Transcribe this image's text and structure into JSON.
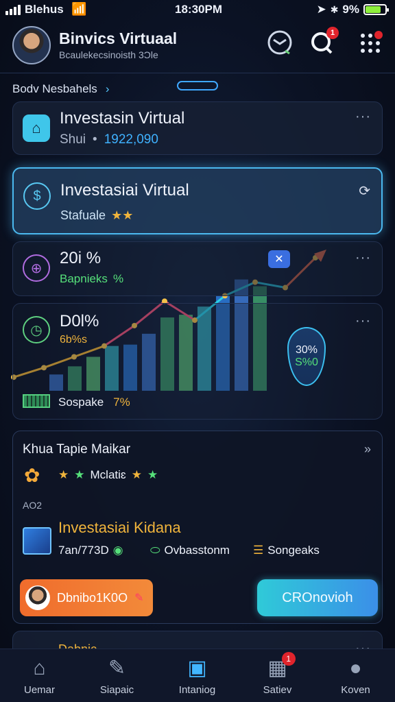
{
  "status_bar": {
    "carrier": "Blehus",
    "time": "18:30PM",
    "battery_text": "9%"
  },
  "header": {
    "title": "Binvics Virtuaal",
    "subtitle": "Bcaulekecsinoisth 3Ͻle",
    "notification_badge": "1"
  },
  "breadcrumb": {
    "label": "Bodv Nesbahels",
    "chevron": "›"
  },
  "cards": {
    "investasi_top": {
      "title": "Investasin Virtual",
      "prefix": "Shui",
      "sep": "•",
      "value": "1922,090"
    },
    "investasi_main": {
      "title": "Investasiai Virtual",
      "sub": "Stafuale",
      "stars": "★★"
    },
    "stat_one": {
      "percent": "20i %",
      "label": "Bapnieks",
      "tag": "%"
    },
    "stat_two": {
      "percent": "D0l%",
      "sub": "6b%s",
      "legend_label": "Sospake",
      "legend_value": "7%",
      "shield_top": "30%",
      "shield_bottom": "S%0"
    }
  },
  "chart_data": {
    "type": "bar",
    "bar_values": [
      12,
      18,
      25,
      33,
      34,
      42,
      54,
      56,
      62,
      70,
      82,
      77
    ],
    "line_values": [
      10,
      17,
      25,
      33,
      48,
      66,
      52,
      70,
      80,
      76,
      98
    ],
    "bar_colors": [
      "#3e7bd8",
      "#41a870",
      "#5fc97a",
      "#36b8c9",
      "#2d7fe0"
    ],
    "line_colors": [
      "#f3b431",
      "#f25278",
      "#29d0e8",
      "#f46b45"
    ]
  },
  "market_card": {
    "title": "Khua Tapie Maikar",
    "stars_label": "Mclatiɛ",
    "minor": "AO2",
    "highlight_title": "Investasiai Kidana",
    "stat_one": "7an/773D",
    "stat_two": "Ovbasstonm",
    "stat_three": "Songeaks",
    "button_left": "Dbnibo1K0O",
    "button_right": "CROnovioh"
  },
  "footer_card": {
    "label": "Dabnic"
  },
  "bottom_nav": [
    {
      "label": "Uemar",
      "icon": "home-icon"
    },
    {
      "label": "Siapaic",
      "icon": "edit-icon"
    },
    {
      "label": "Intaniog",
      "icon": "invest-icon"
    },
    {
      "label": "Satiev",
      "icon": "calendar-icon",
      "badge": "1"
    },
    {
      "label": "Koven",
      "icon": "profile-icon"
    }
  ],
  "colors": {
    "accent": "#42b6ff",
    "background": "#0b1224",
    "alert": "#e0242c",
    "cta_orange": "#f06c2c",
    "cta_cyan": "#3ac6e6"
  }
}
